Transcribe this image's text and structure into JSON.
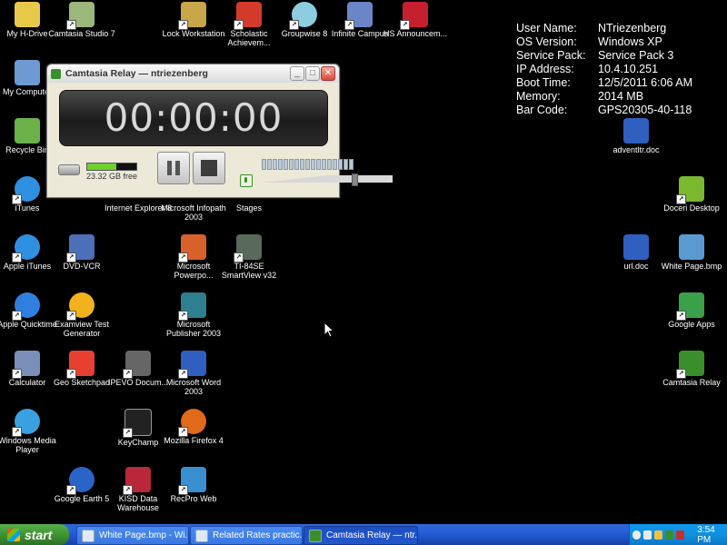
{
  "desktop": {
    "icons": [
      {
        "label": "My H-Drive",
        "color": "#e8c84a"
      },
      {
        "label": "Camtasia Studio 7",
        "color": "#9bb77a"
      },
      {
        "label": "Lock Workstation",
        "color": "#c9a64a"
      },
      {
        "label": "Scholastic Achievem...",
        "color": "#d33a2c"
      },
      {
        "label": "Groupwise 8",
        "color": "#8ecde0"
      },
      {
        "label": "Infinite Campus",
        "color": "#6a86c8"
      },
      {
        "label": "HS Announcem...",
        "color": "#c6202e"
      },
      {
        "label": "My Computer",
        "color": "#6d9ad3"
      },
      {
        "label": "Recycle Bin",
        "color": "#6bb24a"
      },
      {
        "label": "iTunes",
        "color": "#2f8fe0"
      },
      {
        "label": "Apple iTunes",
        "color": "#2f8fe0"
      },
      {
        "label": "DVD-VCR",
        "color": "#4b6fb8"
      },
      {
        "label": "Apple Quicktime",
        "color": "#2f7fe0"
      },
      {
        "label": "Examview Test Generator",
        "color": "#f2b21d"
      },
      {
        "label": "Calculator",
        "color": "#7a8fb8"
      },
      {
        "label": "Geo Sketchpad",
        "color": "#e84030"
      },
      {
        "label": "Windows Media Player",
        "color": "#3aa0e0"
      },
      {
        "label": "Google Earth 5",
        "color": "#2a64c8"
      },
      {
        "label": "Internet Explorer 8",
        "color": "#2f8fe0"
      },
      {
        "label": "Microsoft Infopath 2003",
        "color": "#6a4fb8"
      },
      {
        "label": "Stages",
        "color": "#3f7fd0"
      },
      {
        "label": "Microsoft Powerpo...",
        "color": "#d8602a"
      },
      {
        "label": "TI-84SE SmartView v32",
        "color": "#5a6a5a"
      },
      {
        "label": "Microsoft Publisher 2003",
        "color": "#2e7f8f"
      },
      {
        "label": "IPEVO Docum...",
        "color": "#666666"
      },
      {
        "label": "Microsoft Word 2003",
        "color": "#2f5fbf"
      },
      {
        "label": "KeyChamp",
        "color": "#222222"
      },
      {
        "label": "Mozilla Firefox 4",
        "color": "#e06a1a"
      },
      {
        "label": "KISD Data Warehouse",
        "color": "#b8283a"
      },
      {
        "label": "RecPro Web",
        "color": "#3a8fd0"
      },
      {
        "label": "adventltr.doc",
        "color": "#2f5fbf"
      },
      {
        "label": "Doceri Desktop",
        "color": "#7ab830"
      },
      {
        "label": "url.doc",
        "color": "#2f5fbf"
      },
      {
        "label": "White Page.bmp",
        "color": "#5a9ad0"
      },
      {
        "label": "Google Apps",
        "color": "#3aa04a"
      },
      {
        "label": "Camtasia Relay",
        "color": "#3a8f2c"
      }
    ]
  },
  "sysinfo": [
    {
      "key": "User Name:",
      "value": "NTriezenberg"
    },
    {
      "key": "OS Version:",
      "value": "Windows XP"
    },
    {
      "key": "Service Pack:",
      "value": "Service Pack 3"
    },
    {
      "key": "IP Address:",
      "value": "10.4.10.251"
    },
    {
      "key": "Boot Time:",
      "value": "12/5/2011 6:06 AM"
    },
    {
      "key": "Memory:",
      "value": "2014 MB"
    },
    {
      "key": "Bar Code:",
      "value": "GPS20305-40-118"
    }
  ],
  "camtasia": {
    "title": "Camtasia Relay — ntriezenberg",
    "timer": "00:00:00",
    "disk_free": "23.32 GB free",
    "disk_level": 0.6,
    "volume_level": 0.72
  },
  "taskbar": {
    "start_label": "start",
    "tasks": [
      {
        "label": "White Page.bmp - Wi..."
      },
      {
        "label": "Related Rates practic..."
      },
      {
        "label": "Camtasia Relay — ntr..."
      }
    ],
    "clock": "3:54 PM"
  }
}
